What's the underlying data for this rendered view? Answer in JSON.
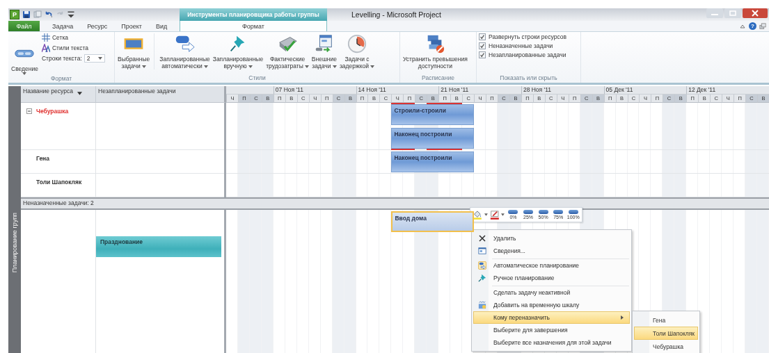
{
  "window": {
    "app_letter": "P",
    "title": "Levelling - Microsoft Project",
    "contextual_group": "Инструменты планировщика работы группы",
    "help_glyph": "?"
  },
  "tabs": [
    {
      "label": "Файл",
      "kind": "file",
      "selected": false
    },
    {
      "label": "Задача",
      "kind": "plain",
      "selected": false
    },
    {
      "label": "Ресурс",
      "kind": "plain",
      "selected": false
    },
    {
      "label": "Проект",
      "kind": "plain",
      "selected": false
    },
    {
      "label": "Вид",
      "kind": "plain",
      "selected": false
    },
    {
      "label": "Формат",
      "kind": "contextual",
      "selected": true
    }
  ],
  "ribbon": {
    "format": {
      "label": "Формат",
      "summary_button": "Сведение",
      "grid": "Сетка",
      "text_styles": "Стили текста",
      "text_rows_label": "Строки текста:",
      "text_rows_value": "2"
    },
    "styles": {
      "label": "Стили",
      "buttons": [
        {
          "lines": [
            "Выбранные",
            "задачи"
          ],
          "kind": "bar",
          "dropdown": true
        },
        {
          "lines": [
            "Запланированные",
            "автоматически"
          ],
          "kind": "auto",
          "dropdown": true
        },
        {
          "lines": [
            "Запланированные",
            "вручную"
          ],
          "kind": "pin",
          "dropdown": true
        },
        {
          "lines": [
            "Фактические",
            "трудозатраты"
          ],
          "kind": "actual",
          "dropdown": true
        },
        {
          "lines": [
            "Внешние",
            "задачи"
          ],
          "kind": "external",
          "dropdown": true
        },
        {
          "lines": [
            "Задачи с",
            "задержкой"
          ],
          "kind": "late",
          "dropdown": true
        }
      ]
    },
    "schedule": {
      "label": "Расписание",
      "button_lines": [
        "Устранить превышения",
        "доступности"
      ]
    },
    "show_hide": {
      "label": "Показать или скрыть",
      "checkboxes": [
        {
          "label": "Развернуть строки ресурсов",
          "checked": true
        },
        {
          "label": "Неназначенные задачи",
          "checked": true
        },
        {
          "label": "Незапланированные задачи",
          "checked": true
        }
      ]
    }
  },
  "side_label": "Планирование групп",
  "columns": [
    {
      "label": "Название ресурса",
      "filter": true
    },
    {
      "label": "Незапланированные задачи",
      "filter": false
    }
  ],
  "timeline": {
    "weeks": [
      {
        "days": [
          {
            "label": "Ч",
            "nonworking": false
          },
          {
            "label": "П",
            "nonworking": true
          },
          {
            "label": "С",
            "nonworking": true
          },
          {
            "label": "В",
            "nonworking": true
          }
        ]
      },
      {
        "label": "07 Ноя '11",
        "days": [
          {
            "label": "П",
            "nonworking": false
          },
          {
            "label": "В",
            "nonworking": false
          },
          {
            "label": "С",
            "nonworking": false
          },
          {
            "label": "Ч",
            "nonworking": false
          },
          {
            "label": "П",
            "nonworking": false
          },
          {
            "label": "С",
            "nonworking": true
          },
          {
            "label": "В",
            "nonworking": true
          }
        ]
      },
      {
        "label": "14 Ноя '11",
        "days": [
          {
            "label": "П",
            "nonworking": false
          },
          {
            "label": "В",
            "nonworking": false
          },
          {
            "label": "С",
            "nonworking": false
          },
          {
            "label": "Ч",
            "nonworking": false
          },
          {
            "label": "П",
            "nonworking": false
          },
          {
            "label": "С",
            "nonworking": true
          },
          {
            "label": "В",
            "nonworking": true
          }
        ]
      },
      {
        "label": "21 Ноя '11",
        "days": [
          {
            "label": "П",
            "nonworking": false
          },
          {
            "label": "В",
            "nonworking": false
          },
          {
            "label": "С",
            "nonworking": false
          },
          {
            "label": "Ч",
            "nonworking": false
          },
          {
            "label": "П",
            "nonworking": false
          },
          {
            "label": "С",
            "nonworking": true
          },
          {
            "label": "В",
            "nonworking": true
          }
        ]
      },
      {
        "label": "28 Ноя '11",
        "days": [
          {
            "label": "П",
            "nonworking": false
          },
          {
            "label": "В",
            "nonworking": false
          },
          {
            "label": "С",
            "nonworking": false
          },
          {
            "label": "Ч",
            "nonworking": false
          },
          {
            "label": "П",
            "nonworking": false
          },
          {
            "label": "С",
            "nonworking": true
          },
          {
            "label": "В",
            "nonworking": true
          }
        ]
      },
      {
        "label": "05 Дек '11",
        "days": [
          {
            "label": "П",
            "nonworking": false
          },
          {
            "label": "В",
            "nonworking": false
          },
          {
            "label": "С",
            "nonworking": false
          },
          {
            "label": "Ч",
            "nonworking": false
          },
          {
            "label": "П",
            "nonworking": false
          },
          {
            "label": "С",
            "nonworking": true
          },
          {
            "label": "В",
            "nonworking": true
          }
        ]
      },
      {
        "label": "12 Дек '11",
        "days": [
          {
            "label": "П",
            "nonworking": false
          },
          {
            "label": "В",
            "nonworking": false
          },
          {
            "label": "С",
            "nonworking": false
          },
          {
            "label": "Ч",
            "nonworking": false
          },
          {
            "label": "П",
            "nonworking": false
          },
          {
            "label": "С",
            "nonworking": true
          },
          {
            "label": "В",
            "nonworking": true
          }
        ]
      }
    ]
  },
  "resources": [
    {
      "name": "Чебурашка",
      "expanded": true,
      "overallocated": true,
      "assignments": [
        {
          "label": "Строили-строили"
        },
        {
          "label": "Наконец построили"
        }
      ]
    },
    {
      "name": "Гена",
      "overallocated": false,
      "assignments": [
        {
          "label": "Наконец построили"
        }
      ]
    },
    {
      "name": "Толи Шапокляк",
      "overallocated": false
    }
  ],
  "unassigned": {
    "header": "Неназначенные задачи: 2",
    "unscheduled": [
      {
        "label": "Празднование"
      }
    ],
    "scheduled": [
      {
        "label": "Ввод дома",
        "selected": true
      }
    ]
  },
  "mini_toolbar": {
    "percent_buttons": [
      "0%",
      "25%",
      "50%",
      "75%",
      "100%"
    ]
  },
  "context_menu": {
    "items": [
      {
        "label": "Удалить",
        "kind": "delete",
        "separator_before": false,
        "submenu": false,
        "selected": false
      },
      {
        "label": "Сведения...",
        "kind": "info",
        "separator_before": false,
        "submenu": false,
        "selected": false
      },
      {
        "label": "Автоматическое планирование",
        "kind": "auto",
        "separator_before": true,
        "submenu": false,
        "selected": false
      },
      {
        "label": "Ручное планирование",
        "kind": "manual",
        "separator_before": false,
        "submenu": false,
        "selected": false
      },
      {
        "label": "Сделать задачу неактивной",
        "kind": "plain",
        "separator_before": true,
        "submenu": false,
        "selected": false
      },
      {
        "label": "Добавить на временную шкалу",
        "kind": "timeline",
        "separator_before": false,
        "submenu": false,
        "selected": false
      },
      {
        "label": "Кому переназначить",
        "kind": "plain",
        "separator_before": false,
        "submenu": true,
        "selected": true
      },
      {
        "label": "Выберите для завершения",
        "kind": "plain",
        "separator_before": false,
        "submenu": false,
        "selected": false
      },
      {
        "label": "Выберите все назначения для этой задачи",
        "kind": "plain",
        "separator_before": false,
        "submenu": false,
        "selected": false
      }
    ],
    "submenu": [
      {
        "label": "Гена",
        "selected": false
      },
      {
        "label": "Толи Шапокляк",
        "selected": true
      },
      {
        "label": "Чебурашка",
        "selected": false
      }
    ]
  }
}
